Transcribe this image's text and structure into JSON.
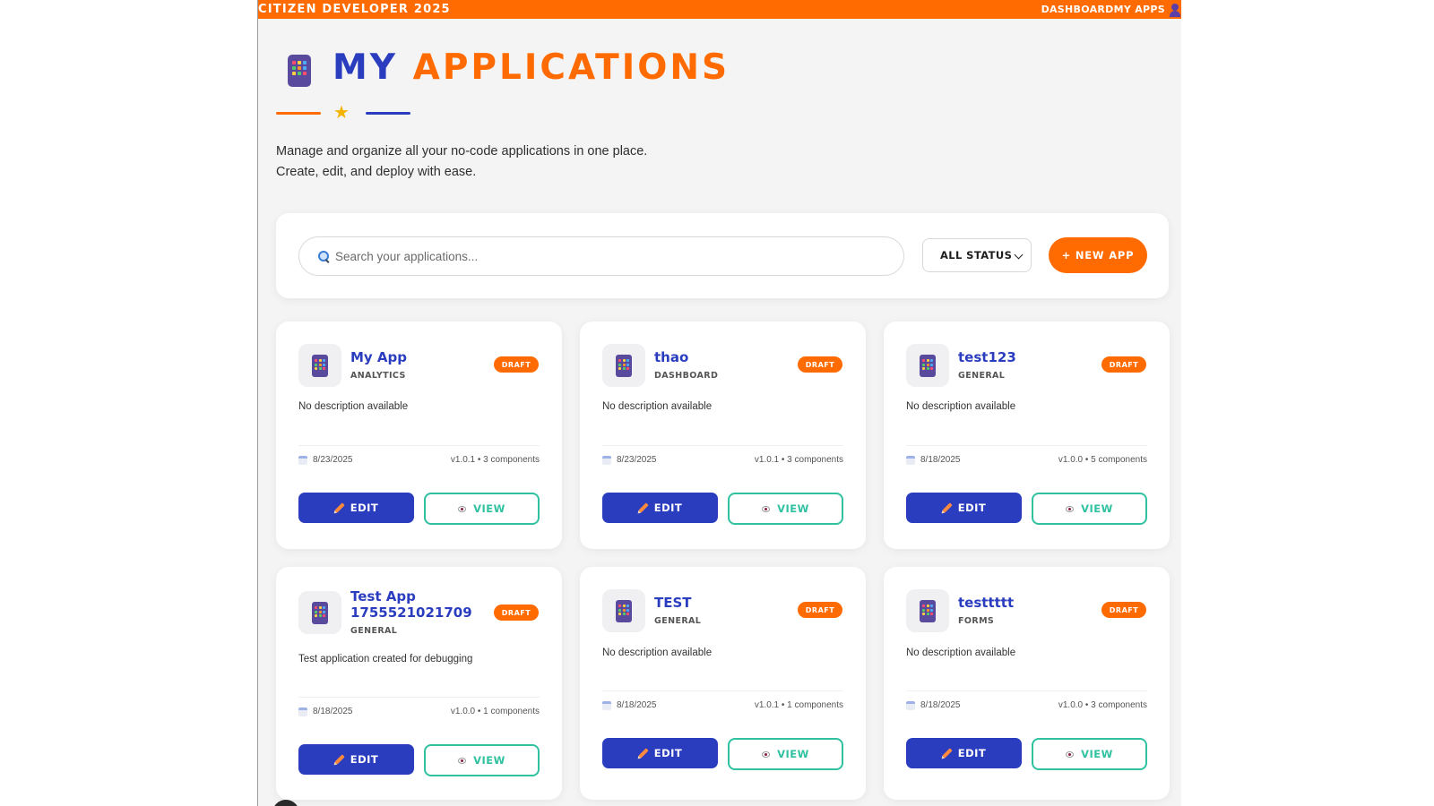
{
  "header": {
    "brand": "CITIZEN DEVELOPER 2025",
    "nav": [
      "DASHBOARD",
      "MY APPS"
    ],
    "user_icon": "user-icon"
  },
  "page": {
    "title_part1": "MY",
    "title_part2": "APPLICATIONS",
    "title_icon": "tablet-icon",
    "divider_icon": "star-icon",
    "subtitle_line1": "Manage and organize all your no-code applications in one place.",
    "subtitle_line2": "Create, edit, and deploy with ease."
  },
  "toolbar": {
    "search_placeholder": "Search your applications...",
    "search_value": "",
    "status_filter": "ALL STATUS",
    "new_app_label": "+ NEW APP"
  },
  "apps": [
    {
      "name": "My App",
      "category": "ANALYTICS",
      "status": "DRAFT",
      "description": "No description available",
      "date": "8/23/2025",
      "meta": "v1.0.1 • 3 components",
      "edit_label": "EDIT",
      "view_label": "VIEW"
    },
    {
      "name": "thao",
      "category": "DASHBOARD",
      "status": "DRAFT",
      "description": "No description available",
      "date": "8/23/2025",
      "meta": "v1.0.1 • 3 components",
      "edit_label": "EDIT",
      "view_label": "VIEW"
    },
    {
      "name": "test123",
      "category": "GENERAL",
      "status": "DRAFT",
      "description": "No description available",
      "date": "8/18/2025",
      "meta": "v1.0.0 • 5 components",
      "edit_label": "EDIT",
      "view_label": "VIEW"
    },
    {
      "name": "Test App 1755521021709",
      "category": "GENERAL",
      "status": "DRAFT",
      "description": "Test application created for debugging",
      "date": "8/18/2025",
      "meta": "v1.0.0 • 1 components",
      "edit_label": "EDIT",
      "view_label": "VIEW"
    },
    {
      "name": "TEST",
      "category": "GENERAL",
      "status": "DRAFT",
      "description": "No description available",
      "date": "8/18/2025",
      "meta": "v1.0.1 • 1 components",
      "edit_label": "EDIT",
      "view_label": "VIEW"
    },
    {
      "name": "testtttt",
      "category": "FORMS",
      "status": "DRAFT",
      "description": "No description available",
      "date": "8/18/2025",
      "meta": "v1.0.0 • 3 components",
      "edit_label": "EDIT",
      "view_label": "VIEW"
    }
  ],
  "colors": {
    "accent": "#ff6b00",
    "primary": "#2b3dbf",
    "view": "#2fc1a0",
    "background": "#f4f4f5"
  }
}
